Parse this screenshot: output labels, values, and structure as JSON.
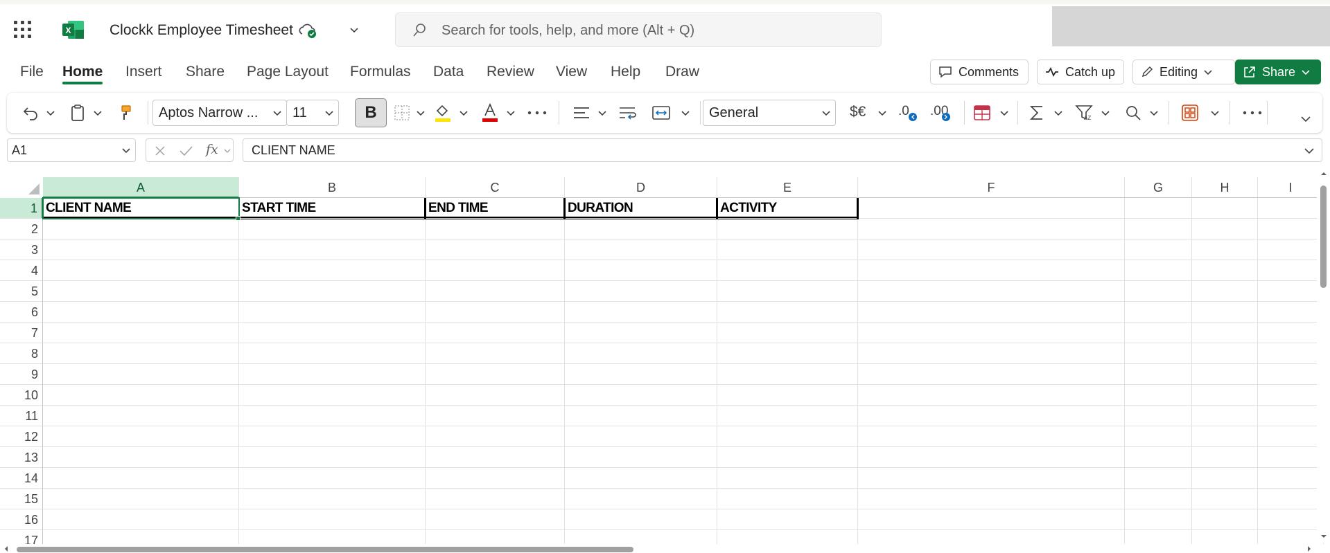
{
  "app": {
    "title": "Clockk Employee Timesheet",
    "search_placeholder": "Search for tools, help, and more (Alt + Q)",
    "accent_color": "#107c41"
  },
  "ribbon": {
    "tabs": [
      "File",
      "Home",
      "Insert",
      "Share",
      "Page Layout",
      "Formulas",
      "Data",
      "Review",
      "View",
      "Help",
      "Draw"
    ],
    "active_tab": "Home",
    "comments_label": "Comments",
    "catchup_label": "Catch up",
    "editing_label": "Editing",
    "share_label": "Share"
  },
  "toolbar": {
    "font_name": "Aptos Narrow ...",
    "font_size": "11",
    "bold_label": "B",
    "number_format": "General",
    "currency_label": "$€",
    "dec_inc_label": ".0",
    "dec_dec_label": ".00"
  },
  "formula_bar": {
    "name_box": "A1",
    "fx_label": "fx",
    "formula": "CLIENT NAME"
  },
  "sheet": {
    "columns": [
      "A",
      "B",
      "C",
      "D",
      "E",
      "F",
      "G",
      "H",
      "I"
    ],
    "rows": [
      "1",
      "2",
      "3",
      "4",
      "5",
      "6",
      "7",
      "8",
      "9",
      "10",
      "11",
      "12",
      "13",
      "14",
      "15",
      "16",
      "17"
    ],
    "selected_cell": "A1",
    "header_row": [
      "CLIENT NAME",
      "START TIME",
      "END TIME",
      "DURATION",
      "ACTIVITY"
    ]
  },
  "icons": {
    "app_launcher": "waffle-icon",
    "excel_logo": "excel-logo-icon",
    "sync": "cloud-saved-icon",
    "search": "search-icon"
  }
}
